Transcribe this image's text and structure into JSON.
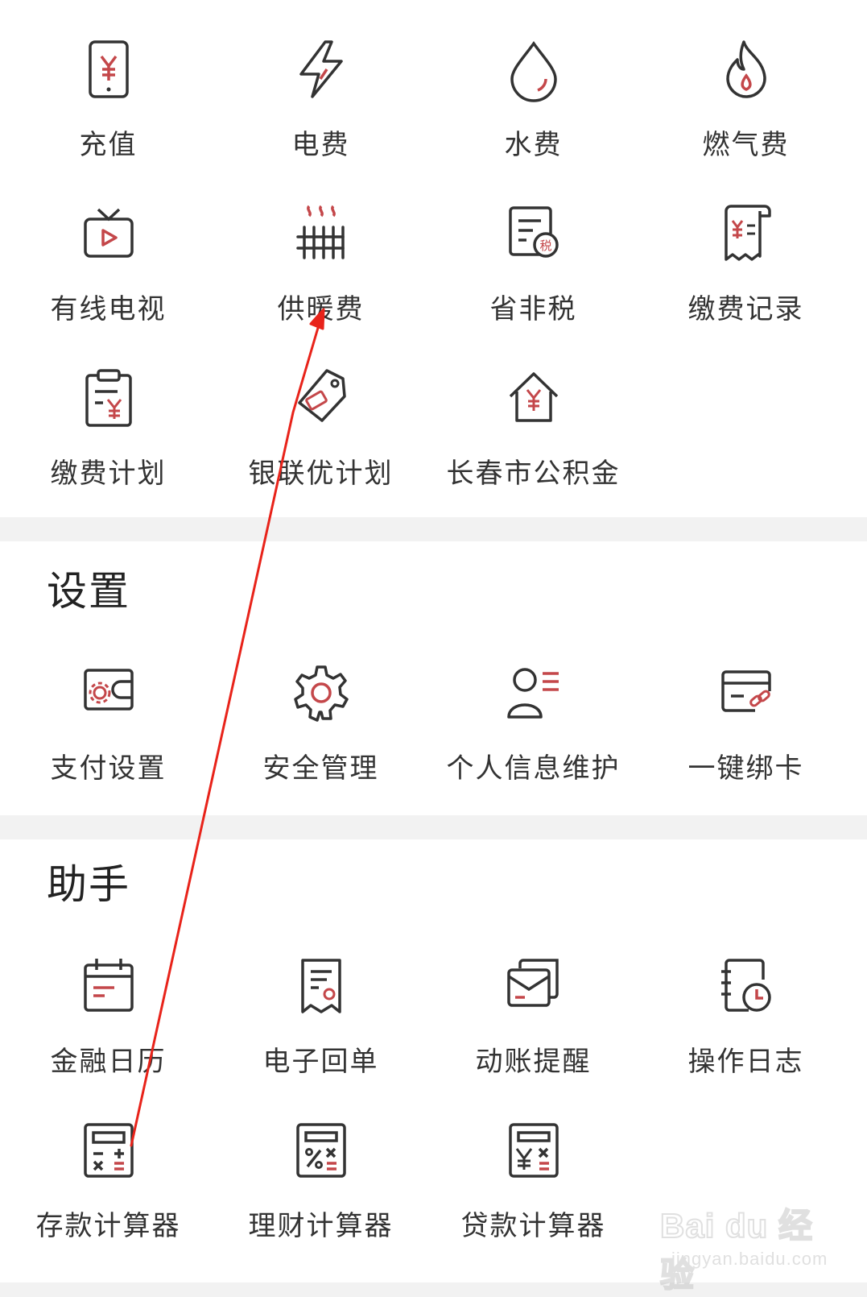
{
  "colors": {
    "icon_stroke": "#333333",
    "icon_accent": "#c4474a",
    "background": "#f2f2f2",
    "card": "#ffffff",
    "annotation_arrow": "#e8231a"
  },
  "payments": {
    "items": [
      {
        "label": "充值",
        "icon": "phone-topup-icon"
      },
      {
        "label": "电费",
        "icon": "lightning-icon"
      },
      {
        "label": "水费",
        "icon": "water-drop-icon"
      },
      {
        "label": "燃气费",
        "icon": "flame-icon"
      },
      {
        "label": "有线电视",
        "icon": "tv-icon"
      },
      {
        "label": "供暖费",
        "icon": "radiator-icon"
      },
      {
        "label": "省非税",
        "icon": "tax-doc-icon"
      },
      {
        "label": "缴费记录",
        "icon": "receipt-icon"
      },
      {
        "label": "缴费计划",
        "icon": "clipboard-icon"
      },
      {
        "label": "银联优计划",
        "icon": "tag-card-icon"
      },
      {
        "label": "长春市公积金",
        "icon": "house-yuan-icon"
      }
    ]
  },
  "settings": {
    "title": "设置",
    "items": [
      {
        "label": "支付设置",
        "icon": "wallet-gear-icon"
      },
      {
        "label": "安全管理",
        "icon": "gear-icon"
      },
      {
        "label": "个人信息维护",
        "icon": "user-list-icon"
      },
      {
        "label": "一键绑卡",
        "icon": "card-link-icon"
      }
    ]
  },
  "assistant": {
    "title": "助手",
    "items": [
      {
        "label": "金融日历",
        "icon": "calendar-icon"
      },
      {
        "label": "电子回单",
        "icon": "e-receipt-icon"
      },
      {
        "label": "动账提醒",
        "icon": "envelope-icon"
      },
      {
        "label": "操作日志",
        "icon": "log-clock-icon"
      },
      {
        "label": "存款计算器",
        "icon": "calculator-icon"
      },
      {
        "label": "理财计算器",
        "icon": "percent-calculator-icon"
      },
      {
        "label": "贷款计算器",
        "icon": "yuan-calculator-icon"
      }
    ]
  },
  "watermark": {
    "main": "Bai du 经验",
    "sub": "jingyan.baidu.com"
  }
}
